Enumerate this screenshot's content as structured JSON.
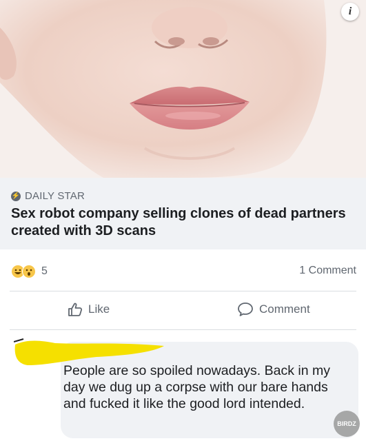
{
  "post": {
    "source": "DAILY STAR",
    "headline": "Sex robot company selling clones of dead partners created with 3D scans",
    "reaction_count": "5",
    "comment_count": "1 Comment",
    "like_label": "Like",
    "comment_label": "Comment"
  },
  "comment": {
    "text": "People are so spoiled nowadays. Back in my day we dug up a corpse with our bare hands and fucked it like the good lord intended."
  },
  "watermark": "BIRDZ",
  "info_glyph": "i",
  "colors": {
    "link_box_bg": "#f0f2f5",
    "text_secondary": "#606770",
    "redaction": "#f5e000"
  }
}
